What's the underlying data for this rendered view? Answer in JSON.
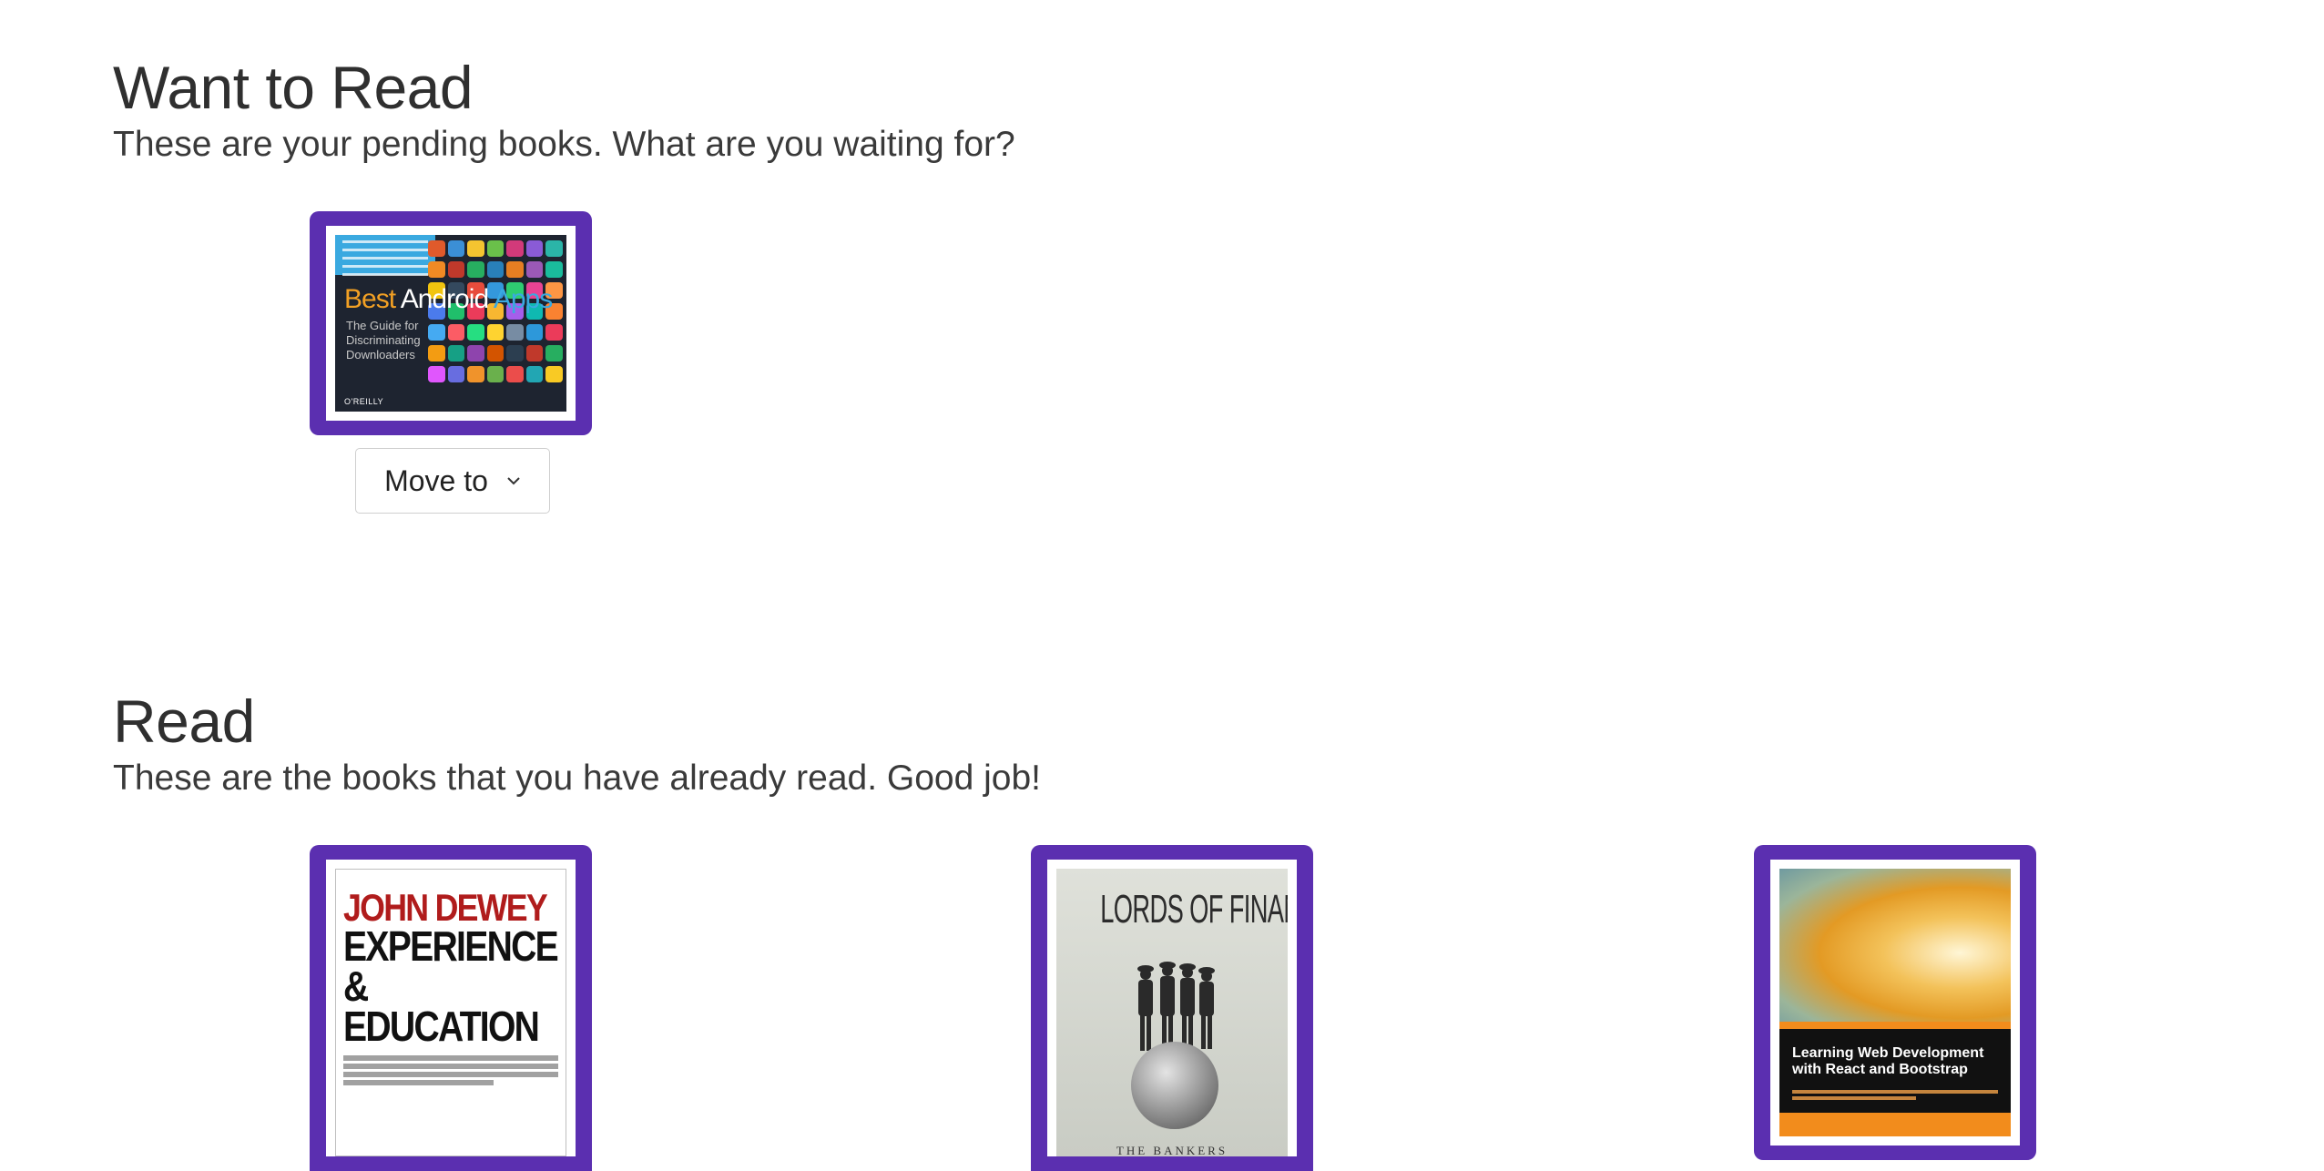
{
  "shelves": {
    "want_to_read": {
      "title": "Want to Read",
      "subtitle": "These are your pending books. What are you waiting for?",
      "books": [
        {
          "cover": {
            "title_part1": "Best",
            "title_part2": "Android",
            "title_part3": "Apps",
            "subtitle": "The Guide for\nDiscriminating\nDownloaders",
            "publisher": "O'REILLY"
          },
          "action_label": "Move to"
        }
      ]
    },
    "read": {
      "title": "Read",
      "subtitle": "These are the books that you have already read. Good job!",
      "books": [
        {
          "cover": {
            "author": "JOHN DEWEY",
            "title": "EXPERIENCE\n& EDUCATION"
          }
        },
        {
          "cover": {
            "title": "LORDS OF FINANCE",
            "subtitle": "THE BANKERS\nWHO BROKE THE WORLD"
          }
        },
        {
          "cover": {
            "title": "Learning Web Development with React and Bootstrap"
          }
        }
      ]
    }
  },
  "colors": {
    "frame": "#5b2fb0",
    "heading": "#2f2f2f",
    "button_border": "#cfcfcf"
  }
}
